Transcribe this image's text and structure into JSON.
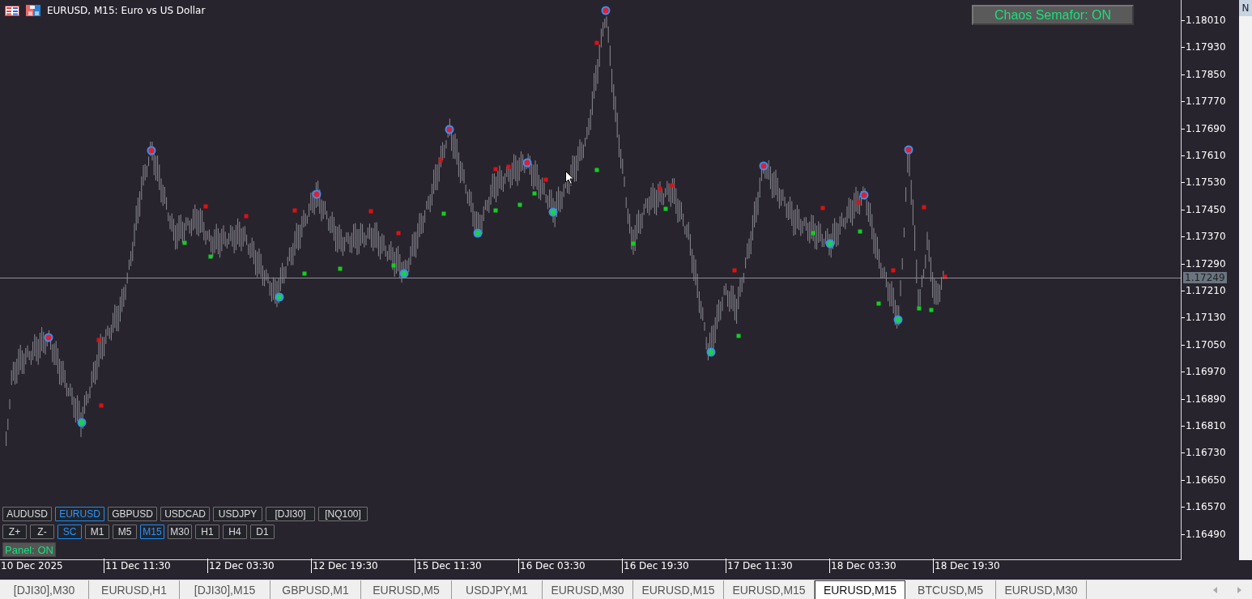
{
  "window": {
    "title": "EURUSD, M15:  Euro vs US Dollar"
  },
  "indicator_button": {
    "label": "Chaos Semafor: ON"
  },
  "price_axis": {
    "ticks": [
      "1.18010",
      "1.17930",
      "1.17850",
      "1.17770",
      "1.17690",
      "1.17610",
      "1.17530",
      "1.17450",
      "1.17370",
      "1.17290",
      "1.17210",
      "1.17130",
      "1.17050",
      "1.16970",
      "1.16890",
      "1.16810",
      "1.16730",
      "1.16650",
      "1.16570",
      "1.16490"
    ],
    "current_price": "1.17249"
  },
  "time_axis": {
    "ticks": [
      "10 Dec 2025",
      "11 Dec 11:30",
      "12 Dec 03:30",
      "12 Dec 19:30",
      "15 Dec 11:30",
      "16 Dec 03:30",
      "16 Dec 19:30",
      "17 Dec 11:30",
      "18 Dec 03:30",
      "18 Dec 19:30"
    ]
  },
  "symbol_buttons": [
    {
      "label": "AUDUSD",
      "selected": false
    },
    {
      "label": "EURUSD",
      "selected": true
    },
    {
      "label": "GBPUSD",
      "selected": false
    },
    {
      "label": "USDCAD",
      "selected": false
    },
    {
      "label": "USDJPY",
      "selected": false
    },
    {
      "label": "[DJI30]",
      "selected": false
    },
    {
      "label": "[NQ100]",
      "selected": false
    }
  ],
  "timeframe_buttons": [
    {
      "label": "Z+",
      "selected": false
    },
    {
      "label": "Z-",
      "selected": false
    },
    {
      "label": "SC",
      "selected": true
    },
    {
      "label": "M1",
      "selected": false
    },
    {
      "label": "M5",
      "selected": false
    },
    {
      "label": "M15",
      "selected": true
    },
    {
      "label": "M30",
      "selected": false
    },
    {
      "label": "H1",
      "selected": false
    },
    {
      "label": "H4",
      "selected": false
    },
    {
      "label": "D1",
      "selected": false
    }
  ],
  "panel_toggle": {
    "label": "Panel: ON"
  },
  "side_tab": {
    "label": "N"
  },
  "chart_tabs": [
    {
      "label": "[DJI30],M30",
      "selected": false
    },
    {
      "label": "EURUSD,H1",
      "selected": false
    },
    {
      "label": "[DJI30],M15",
      "selected": false
    },
    {
      "label": "GBPUSD,M1",
      "selected": false
    },
    {
      "label": "EURUSD,M5",
      "selected": false
    },
    {
      "label": "USDJPY,M1",
      "selected": false
    },
    {
      "label": "EURUSD,M30",
      "selected": false
    },
    {
      "label": "EURUSD,M15",
      "selected": false
    },
    {
      "label": "EURUSD,M15",
      "selected": false
    },
    {
      "label": "EURUSD,M15",
      "selected": true
    },
    {
      "label": "BTCUSD,M5",
      "selected": false
    },
    {
      "label": "EURUSD,M30",
      "selected": false
    }
  ]
}
